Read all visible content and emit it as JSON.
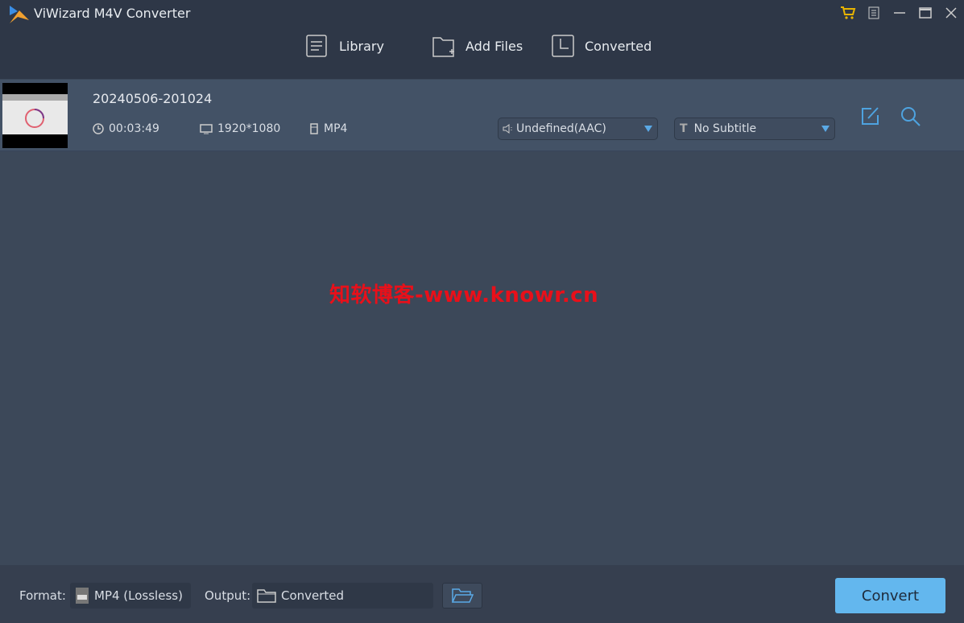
{
  "app": {
    "title": "ViWizard M4V Converter"
  },
  "nav": {
    "library": "Library",
    "add_files": "Add Files",
    "converted": "Converted"
  },
  "file": {
    "name": "20240506-201024",
    "duration": "00:03:49",
    "resolution": "1920*1080",
    "format": "MP4",
    "audio": "Undefined(AAC)",
    "subtitle": "No Subtitle"
  },
  "watermark": "知软博客-www.knowr.cn",
  "footer": {
    "format_label": "Format:",
    "format_value": "MP4 (Lossless)",
    "output_label": "Output:",
    "output_value": "Converted",
    "convert": "Convert"
  },
  "colors": {
    "accent": "#63b7ee",
    "cart": "#e8b400",
    "watermark": "#e8101a"
  }
}
